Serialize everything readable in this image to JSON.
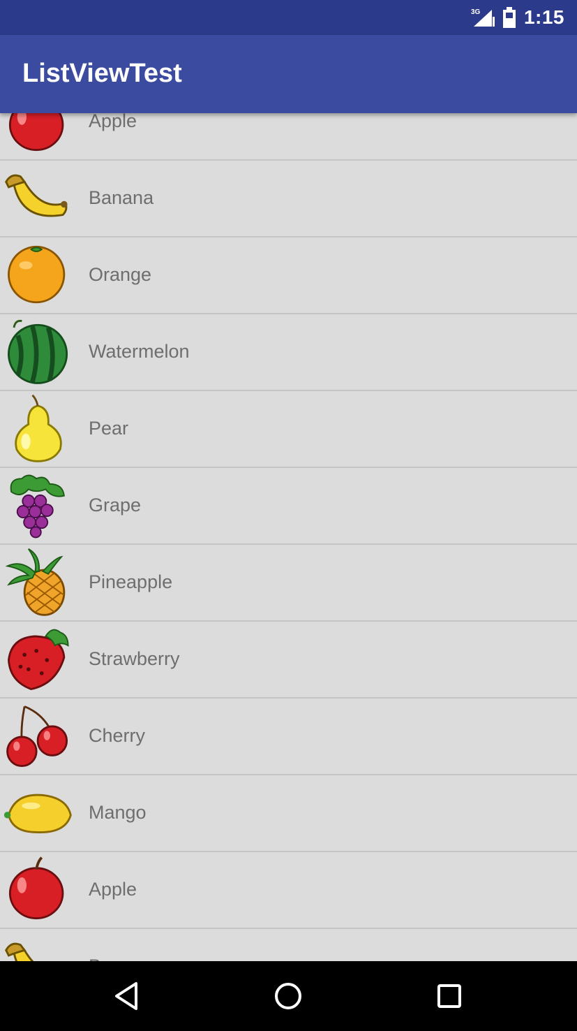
{
  "status_bar": {
    "network_label": "3G",
    "time": "1:15"
  },
  "app_bar": {
    "title": "ListViewTest"
  },
  "list": {
    "items": [
      {
        "name": "Apple",
        "icon": "apple-icon"
      },
      {
        "name": "Banana",
        "icon": "banana-icon"
      },
      {
        "name": "Orange",
        "icon": "orange-icon"
      },
      {
        "name": "Watermelon",
        "icon": "watermelon-icon"
      },
      {
        "name": "Pear",
        "icon": "pear-icon"
      },
      {
        "name": "Grape",
        "icon": "grape-icon"
      },
      {
        "name": "Pineapple",
        "icon": "pineapple-icon"
      },
      {
        "name": "Strawberry",
        "icon": "strawberry-icon"
      },
      {
        "name": "Cherry",
        "icon": "cherry-icon"
      },
      {
        "name": "Mango",
        "icon": "mango-icon"
      },
      {
        "name": "Apple",
        "icon": "apple-icon"
      },
      {
        "name": "Banana",
        "icon": "banana-icon"
      }
    ]
  },
  "nav_bar": {
    "back_icon": "back-icon",
    "home_icon": "home-icon",
    "recents_icon": "recents-icon"
  },
  "colors": {
    "status_bar": "#2c3a8c",
    "app_bar": "#3a4ba0",
    "list_background": "#dcdcdc",
    "divider": "#c4c4c4",
    "item_text": "#6e6e6e",
    "nav_bar": "#000000"
  }
}
